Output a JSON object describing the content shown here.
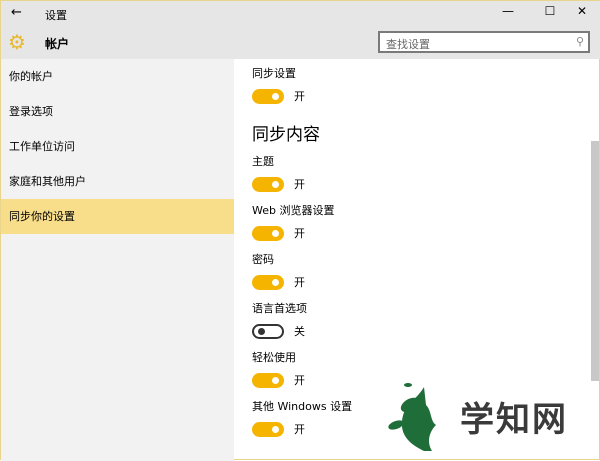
{
  "window": {
    "title": "设置",
    "back": "←",
    "minimize": "—",
    "maximize": "☐",
    "close": "✕"
  },
  "header": {
    "title": "帐户",
    "search_placeholder": "查找设置",
    "search_icon": "⚲"
  },
  "sidebar": {
    "items": [
      {
        "label": "你的帐户"
      },
      {
        "label": "登录选项"
      },
      {
        "label": "工作单位访问"
      },
      {
        "label": "家庭和其他用户"
      },
      {
        "label": "同步你的设置"
      }
    ]
  },
  "main": {
    "sync_settings": {
      "label": "同步设置",
      "state": "开"
    },
    "section_title": "同步内容",
    "items": [
      {
        "label": "主题",
        "state": "开"
      },
      {
        "label": "Web 浏览器设置",
        "state": "开"
      },
      {
        "label": "密码",
        "state": "开"
      },
      {
        "label": "语言首选项",
        "state": "关"
      },
      {
        "label": "轻松使用",
        "state": "开"
      },
      {
        "label": "其他 Windows 设置",
        "state": "开"
      }
    ]
  },
  "watermark": {
    "text": "学知网"
  },
  "colors": {
    "accent": "#f4b400",
    "selected": "#f8dd8a"
  }
}
